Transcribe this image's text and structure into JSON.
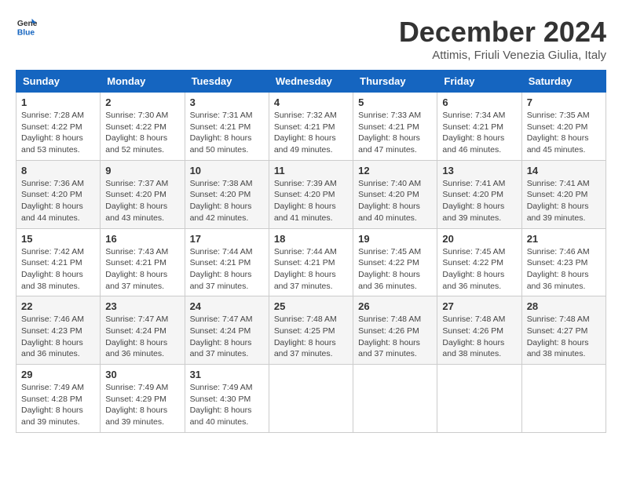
{
  "logo": {
    "general": "General",
    "blue": "Blue"
  },
  "header": {
    "month": "December 2024",
    "location": "Attimis, Friuli Venezia Giulia, Italy"
  },
  "weekdays": [
    "Sunday",
    "Monday",
    "Tuesday",
    "Wednesday",
    "Thursday",
    "Friday",
    "Saturday"
  ],
  "weeks": [
    [
      {
        "day": "1",
        "sunrise": "7:28 AM",
        "sunset": "4:22 PM",
        "daylight": "8 hours and 53 minutes."
      },
      {
        "day": "2",
        "sunrise": "7:30 AM",
        "sunset": "4:22 PM",
        "daylight": "8 hours and 52 minutes."
      },
      {
        "day": "3",
        "sunrise": "7:31 AM",
        "sunset": "4:21 PM",
        "daylight": "8 hours and 50 minutes."
      },
      {
        "day": "4",
        "sunrise": "7:32 AM",
        "sunset": "4:21 PM",
        "daylight": "8 hours and 49 minutes."
      },
      {
        "day": "5",
        "sunrise": "7:33 AM",
        "sunset": "4:21 PM",
        "daylight": "8 hours and 47 minutes."
      },
      {
        "day": "6",
        "sunrise": "7:34 AM",
        "sunset": "4:21 PM",
        "daylight": "8 hours and 46 minutes."
      },
      {
        "day": "7",
        "sunrise": "7:35 AM",
        "sunset": "4:20 PM",
        "daylight": "8 hours and 45 minutes."
      }
    ],
    [
      {
        "day": "8",
        "sunrise": "7:36 AM",
        "sunset": "4:20 PM",
        "daylight": "8 hours and 44 minutes."
      },
      {
        "day": "9",
        "sunrise": "7:37 AM",
        "sunset": "4:20 PM",
        "daylight": "8 hours and 43 minutes."
      },
      {
        "day": "10",
        "sunrise": "7:38 AM",
        "sunset": "4:20 PM",
        "daylight": "8 hours and 42 minutes."
      },
      {
        "day": "11",
        "sunrise": "7:39 AM",
        "sunset": "4:20 PM",
        "daylight": "8 hours and 41 minutes."
      },
      {
        "day": "12",
        "sunrise": "7:40 AM",
        "sunset": "4:20 PM",
        "daylight": "8 hours and 40 minutes."
      },
      {
        "day": "13",
        "sunrise": "7:41 AM",
        "sunset": "4:20 PM",
        "daylight": "8 hours and 39 minutes."
      },
      {
        "day": "14",
        "sunrise": "7:41 AM",
        "sunset": "4:20 PM",
        "daylight": "8 hours and 39 minutes."
      }
    ],
    [
      {
        "day": "15",
        "sunrise": "7:42 AM",
        "sunset": "4:21 PM",
        "daylight": "8 hours and 38 minutes."
      },
      {
        "day": "16",
        "sunrise": "7:43 AM",
        "sunset": "4:21 PM",
        "daylight": "8 hours and 37 minutes."
      },
      {
        "day": "17",
        "sunrise": "7:44 AM",
        "sunset": "4:21 PM",
        "daylight": "8 hours and 37 minutes."
      },
      {
        "day": "18",
        "sunrise": "7:44 AM",
        "sunset": "4:21 PM",
        "daylight": "8 hours and 37 minutes."
      },
      {
        "day": "19",
        "sunrise": "7:45 AM",
        "sunset": "4:22 PM",
        "daylight": "8 hours and 36 minutes."
      },
      {
        "day": "20",
        "sunrise": "7:45 AM",
        "sunset": "4:22 PM",
        "daylight": "8 hours and 36 minutes."
      },
      {
        "day": "21",
        "sunrise": "7:46 AM",
        "sunset": "4:23 PM",
        "daylight": "8 hours and 36 minutes."
      }
    ],
    [
      {
        "day": "22",
        "sunrise": "7:46 AM",
        "sunset": "4:23 PM",
        "daylight": "8 hours and 36 minutes."
      },
      {
        "day": "23",
        "sunrise": "7:47 AM",
        "sunset": "4:24 PM",
        "daylight": "8 hours and 36 minutes."
      },
      {
        "day": "24",
        "sunrise": "7:47 AM",
        "sunset": "4:24 PM",
        "daylight": "8 hours and 37 minutes."
      },
      {
        "day": "25",
        "sunrise": "7:48 AM",
        "sunset": "4:25 PM",
        "daylight": "8 hours and 37 minutes."
      },
      {
        "day": "26",
        "sunrise": "7:48 AM",
        "sunset": "4:26 PM",
        "daylight": "8 hours and 37 minutes."
      },
      {
        "day": "27",
        "sunrise": "7:48 AM",
        "sunset": "4:26 PM",
        "daylight": "8 hours and 38 minutes."
      },
      {
        "day": "28",
        "sunrise": "7:48 AM",
        "sunset": "4:27 PM",
        "daylight": "8 hours and 38 minutes."
      }
    ],
    [
      {
        "day": "29",
        "sunrise": "7:49 AM",
        "sunset": "4:28 PM",
        "daylight": "8 hours and 39 minutes."
      },
      {
        "day": "30",
        "sunrise": "7:49 AM",
        "sunset": "4:29 PM",
        "daylight": "8 hours and 39 minutes."
      },
      {
        "day": "31",
        "sunrise": "7:49 AM",
        "sunset": "4:30 PM",
        "daylight": "8 hours and 40 minutes."
      },
      null,
      null,
      null,
      null
    ]
  ],
  "labels": {
    "sunrise": "Sunrise: ",
    "sunset": "Sunset: ",
    "daylight": "Daylight: "
  }
}
